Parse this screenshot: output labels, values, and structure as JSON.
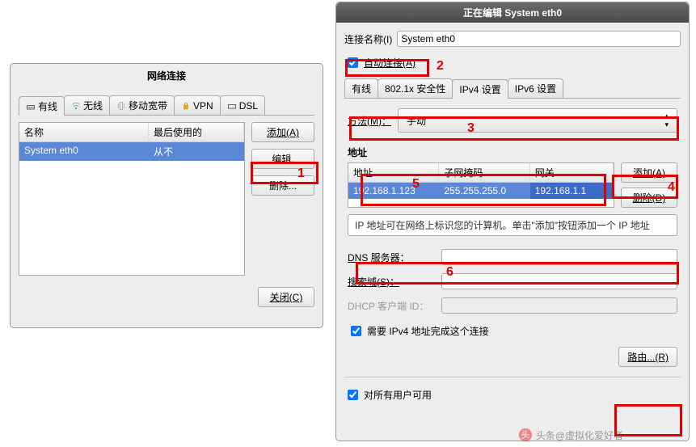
{
  "win1": {
    "title": "网络连接",
    "tabs": {
      "t0": "有线",
      "t1": "无线",
      "t2": "移动宽带",
      "t3": "VPN",
      "t4": "DSL"
    },
    "cols": {
      "name": "名称",
      "last": "最后使用的"
    },
    "row": {
      "name": "System eth0",
      "last": "从不"
    },
    "btns": {
      "add": "添加(A)",
      "edit": "编辑.",
      "del": "删除...",
      "close": "关闭(C)"
    }
  },
  "win2": {
    "title": "正在编辑 System eth0",
    "conn_label": "连接名称(I)",
    "conn_value": "System eth0",
    "autoconnect": "自动连接(A)",
    "tabs": {
      "t0": "有线",
      "t1": "802.1x 安全性",
      "t2": "IPv4 设置",
      "t3": "IPv6 设置"
    },
    "method_label": "方法(M)：",
    "method_value": "手动",
    "addr_section": "地址",
    "addr_cols": {
      "ip": "地址",
      "mask": "子网掩码",
      "gw": "网关"
    },
    "addr_row": {
      "ip": "192.168.1.123",
      "mask": "255.255.255.0",
      "gw": "192.168.1.1"
    },
    "btns": {
      "add": "添加(A)",
      "del": "删除(D)",
      "routes": "路由...(R)"
    },
    "hint": "IP 地址可在网络上标识您的计算机。单击\"添加\"按钮添加一个 IP 地址",
    "dns_label": "DNS 服务器：",
    "search_label": "搜索域(S)：",
    "dhcp_label": "DHCP 客户端 ID：",
    "require_ipv4": "需要 IPv4 地址完成这个连接",
    "all_users": "对所有用户可用"
  },
  "annotations": {
    "n1": "1",
    "n2": "2",
    "n3": "3",
    "n4": "4",
    "n5": "5",
    "n6": "6"
  },
  "watermark": "头条@虚拟化爱好者"
}
